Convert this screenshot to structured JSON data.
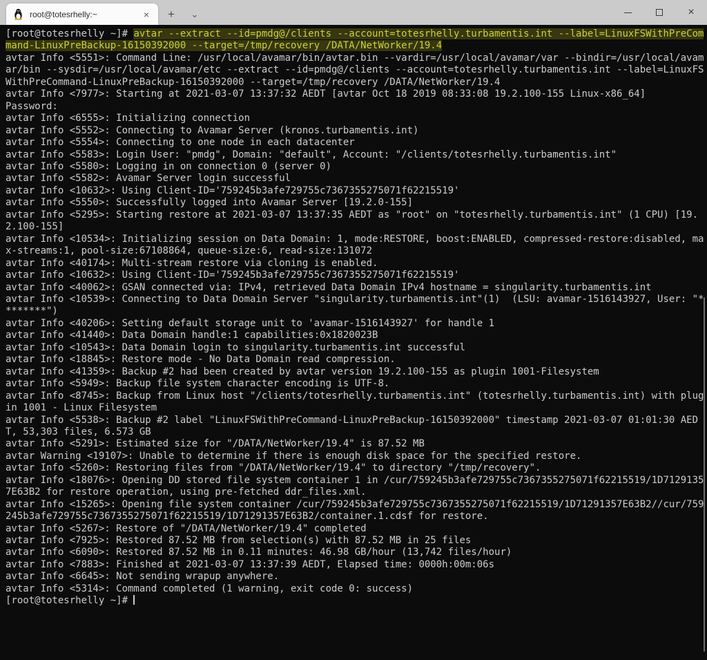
{
  "window": {
    "tab": {
      "title": "root@totesrhelly:~",
      "close_icon": "×"
    },
    "tabbar": {
      "new_tab_icon": "+",
      "dropdown_icon": "⌄"
    },
    "controls": {
      "close_icon": "×"
    }
  },
  "colors": {
    "terminal_background": "#0c0c0c",
    "terminal_foreground": "#cccccc",
    "command_highlight_foreground": "#ccd13c",
    "command_highlight_background": "#373710",
    "tabbar_background": "#cbcbcb",
    "active_tab_background": "#fbfbfb",
    "tux_accent": "#e8a017"
  },
  "terminal": {
    "columns": 120,
    "prompt": "[root@totesrhelly ~]# ",
    "command": "avtar --extract --id=pmdg@/clients --account=totesrhelly.turbamentis.int --label=LinuxFSWithPreCommand-LinuxPreBackup-16150392000 --target=/tmp/recovery /DATA/NetWorker/19.4",
    "output_lines": [
      "avtar Info <5551>: Command Line: /usr/local/avamar/bin/avtar.bin --vardir=/usr/local/avamar/var --bindir=/usr/local/avamar/bin --sysdir=/usr/local/avamar/etc --extract --id=pmdg@/clients --account=totesrhelly.turbamentis.int --label=LinuxFSWithPreCommand-LinuxPreBackup-16150392000 --target=/tmp/recovery /DATA/NetWorker/19.4",
      "avtar Info <7977>: Starting at 2021-03-07 13:37:32 AEDT [avtar Oct 18 2019 08:33:08 19.2.100-155 Linux-x86_64]",
      "Password:",
      "avtar Info <6555>: Initializing connection",
      "avtar Info <5552>: Connecting to Avamar Server (kronos.turbamentis.int)",
      "avtar Info <5554>: Connecting to one node in each datacenter",
      "avtar Info <5583>: Login User: \"pmdg\", Domain: \"default\", Account: \"/clients/totesrhelly.turbamentis.int\"",
      "avtar Info <5580>: Logging in on connection 0 (server 0)",
      "avtar Info <5582>: Avamar Server login successful",
      "avtar Info <10632>: Using Client-ID='759245b3afe729755c7367355275071f62215519'",
      "avtar Info <5550>: Successfully logged into Avamar Server [19.2.0-155]",
      "avtar Info <5295>: Starting restore at 2021-03-07 13:37:35 AEDT as \"root\" on \"totesrhelly.turbamentis.int\" (1 CPU) [19.2.100-155]",
      "avtar Info <10534>: Initializing session on Data Domain: 1, mode:RESTORE, boost:ENABLED, compressed-restore:disabled, max-streams:1, pool-size:67108864, queue-size:6, read-size:131072",
      "avtar Info <40174>: Multi-stream restore via cloning is enabled.",
      "avtar Info <10632>: Using Client-ID='759245b3afe729755c7367355275071f62215519'",
      "avtar Info <40062>: GSAN connected via: IPv4, retrieved Data Domain IPv4 hostname = singularity.turbamentis.int",
      "avtar Info <10539>: Connecting to Data Domain Server \"singularity.turbamentis.int\"(1)  (LSU: avamar-1516143927, User: \"********\")",
      "avtar Info <40206>: Setting default storage unit to 'avamar-1516143927' for handle 1",
      "avtar Info <41440>: Data Domain handle:1 capabilities:0x1820023B",
      "avtar Info <10543>: Data Domain login to singularity.turbamentis.int successful",
      "avtar Info <18845>: Restore mode - No Data Domain read compression.",
      "avtar Info <41359>: Backup #2 had been created by avtar version 19.2.100-155 as plugin 1001-Filesystem",
      "avtar Info <5949>: Backup file system character encoding is UTF-8.",
      "avtar Info <8745>: Backup from Linux host \"/clients/totesrhelly.turbamentis.int\" (totesrhelly.turbamentis.int) with plugin 1001 - Linux Filesystem",
      "avtar Info <5538>: Backup #2 label \"LinuxFSWithPreCommand-LinuxPreBackup-16150392000\" timestamp 2021-03-07 01:01:30 AEDT, 53,303 files, 6.573 GB",
      "avtar Info <5291>: Estimated size for \"/DATA/NetWorker/19.4\" is 87.52 MB",
      "avtar Warning <19107>: Unable to determine if there is enough disk space for the specified restore.",
      "avtar Info <5260>: Restoring files from \"/DATA/NetWorker/19.4\" to directory \"/tmp/recovery\".",
      "avtar Info <18076>: Opening DD stored file system container 1 in /cur/759245b3afe729755c7367355275071f62215519/1D71291357E63B2 for restore operation, using pre-fetched ddr_files.xml.",
      "avtar Info <15265>: Opening file system container /cur/759245b3afe729755c7367355275071f62215519/1D71291357E63B2//cur/759245b3afe729755c7367355275071f62215519/1D71291357E63B2/container.1.cdsf for restore.",
      "avtar Info <5267>: Restore of \"/DATA/NetWorker/19.4\" completed",
      "avtar Info <7925>: Restored 87.52 MB from selection(s) with 87.52 MB in 25 files",
      "avtar Info <6090>: Restored 87.52 MB in 0.11 minutes: 46.98 GB/hour (13,742 files/hour)",
      "avtar Info <7883>: Finished at 2021-03-07 13:37:39 AEDT, Elapsed time: 0000h:00m:06s",
      "avtar Info <6645>: Not sending wrapup anywhere.",
      "avtar Info <5314>: Command completed (1 warning, exit code 0: success)"
    ],
    "final_prompt": "[root@totesrhelly ~]# "
  }
}
